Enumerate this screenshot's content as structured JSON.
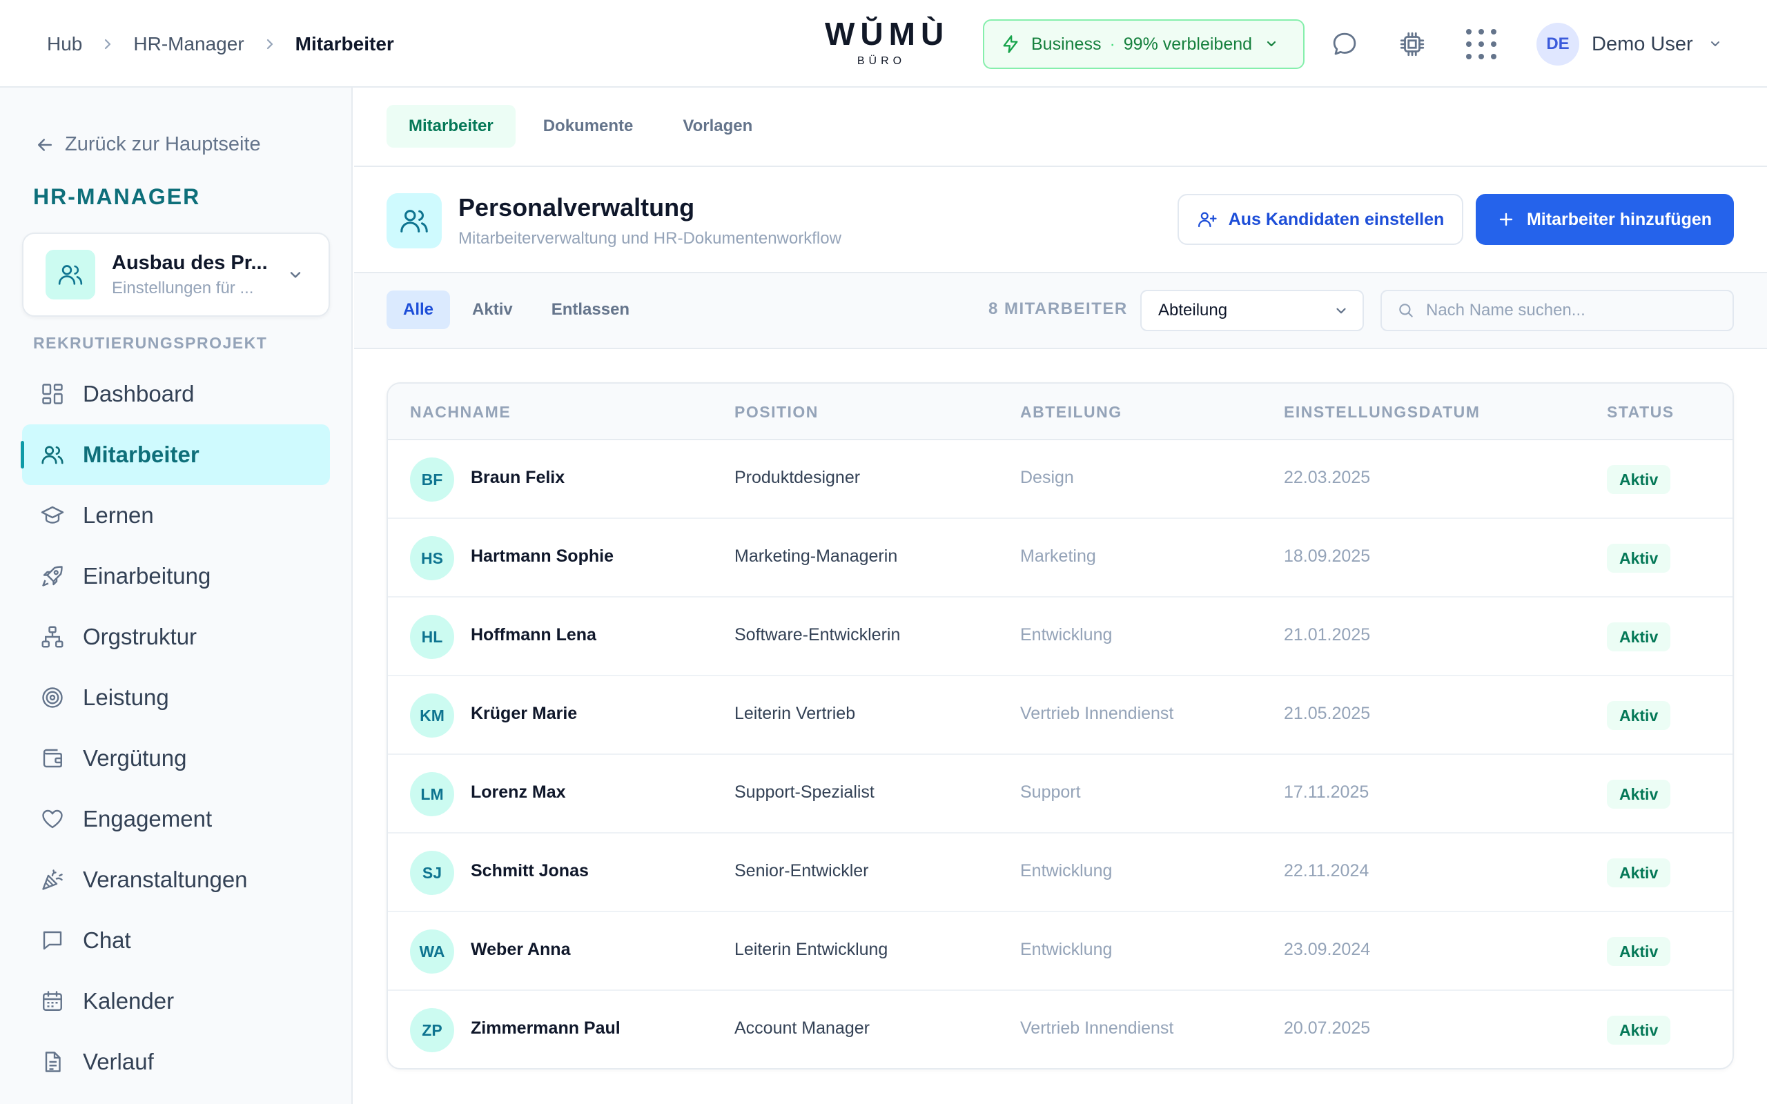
{
  "breadcrumb": {
    "hub": "Hub",
    "manager": "HR-Manager",
    "current": "Mitarbeiter"
  },
  "logo": {
    "word": "WŬMÙ",
    "sub": "BÜRO"
  },
  "plan": {
    "name": "Business",
    "separator": "·",
    "remaining": "99% verbleibend"
  },
  "user": {
    "initials": "DE",
    "name": "Demo User"
  },
  "sidebar": {
    "back": "Zurück zur Hauptseite",
    "title": "HR-MANAGER",
    "project": {
      "name": "Ausbau des Pr...",
      "sub": "Einstellungen für ..."
    },
    "section": "REKRUTIERUNGSPROJEKT",
    "items": [
      {
        "label": "Dashboard",
        "icon": "dashboard-icon"
      },
      {
        "label": "Mitarbeiter",
        "icon": "users-icon",
        "active": true
      },
      {
        "label": "Lernen",
        "icon": "graduation-cap-icon"
      },
      {
        "label": "Einarbeitung",
        "icon": "rocket-icon"
      },
      {
        "label": "Orgstruktur",
        "icon": "org-chart-icon"
      },
      {
        "label": "Leistung",
        "icon": "target-icon"
      },
      {
        "label": "Vergütung",
        "icon": "wallet-icon"
      },
      {
        "label": "Engagement",
        "icon": "heart-icon"
      },
      {
        "label": "Veranstaltungen",
        "icon": "party-icon"
      },
      {
        "label": "Chat",
        "icon": "chat-icon"
      },
      {
        "label": "Kalender",
        "icon": "calendar-icon"
      },
      {
        "label": "Verlauf",
        "icon": "document-icon"
      }
    ]
  },
  "tabs": [
    "Mitarbeiter",
    "Dokumente",
    "Vorlagen"
  ],
  "header": {
    "title": "Personalverwaltung",
    "subtitle": "Mitarbeiterverwaltung und HR-Dokumentenworkflow",
    "btn_candidates": "Aus Kandidaten einstellen",
    "btn_add": "Mitarbeiter hinzufügen"
  },
  "filters": {
    "tabs": [
      "Alle",
      "Aktiv",
      "Entlassen"
    ],
    "count": "8 MITARBEITER",
    "department": "Abteilung",
    "search_placeholder": "Nach Name suchen..."
  },
  "table": {
    "columns": [
      "NACHNAME",
      "POSITION",
      "ABTEILUNG",
      "EINSTELLUNGSDATUM",
      "STATUS"
    ],
    "rows": [
      {
        "initials": "BF",
        "name": "Braun Felix",
        "position": "Produktdesigner",
        "department": "Design",
        "date": "22.03.2025",
        "status": "Aktiv"
      },
      {
        "initials": "HS",
        "name": "Hartmann Sophie",
        "position": "Marketing-Managerin",
        "department": "Marketing",
        "date": "18.09.2025",
        "status": "Aktiv"
      },
      {
        "initials": "HL",
        "name": "Hoffmann Lena",
        "position": "Software-Entwicklerin",
        "department": "Entwicklung",
        "date": "21.01.2025",
        "status": "Aktiv"
      },
      {
        "initials": "KM",
        "name": "Krüger Marie",
        "position": "Leiterin Vertrieb",
        "department": "Vertrieb Innendienst",
        "date": "21.05.2025",
        "status": "Aktiv"
      },
      {
        "initials": "LM",
        "name": "Lorenz Max",
        "position": "Support-Spezialist",
        "department": "Support",
        "date": "17.11.2025",
        "status": "Aktiv"
      },
      {
        "initials": "SJ",
        "name": "Schmitt Jonas",
        "position": "Senior-Entwickler",
        "department": "Entwicklung",
        "date": "22.11.2024",
        "status": "Aktiv"
      },
      {
        "initials": "WA",
        "name": "Weber Anna",
        "position": "Leiterin Entwicklung",
        "department": "Entwicklung",
        "date": "23.09.2024",
        "status": "Aktiv"
      },
      {
        "initials": "ZP",
        "name": "Zimmermann Paul",
        "position": "Account Manager",
        "department": "Vertrieb Innendienst",
        "date": "20.07.2025",
        "status": "Aktiv"
      }
    ]
  },
  "colors": {
    "accent": "#2563eb",
    "teal": "#0e6f7a",
    "active_bg": "#cffafe",
    "status_green": "#047857"
  }
}
